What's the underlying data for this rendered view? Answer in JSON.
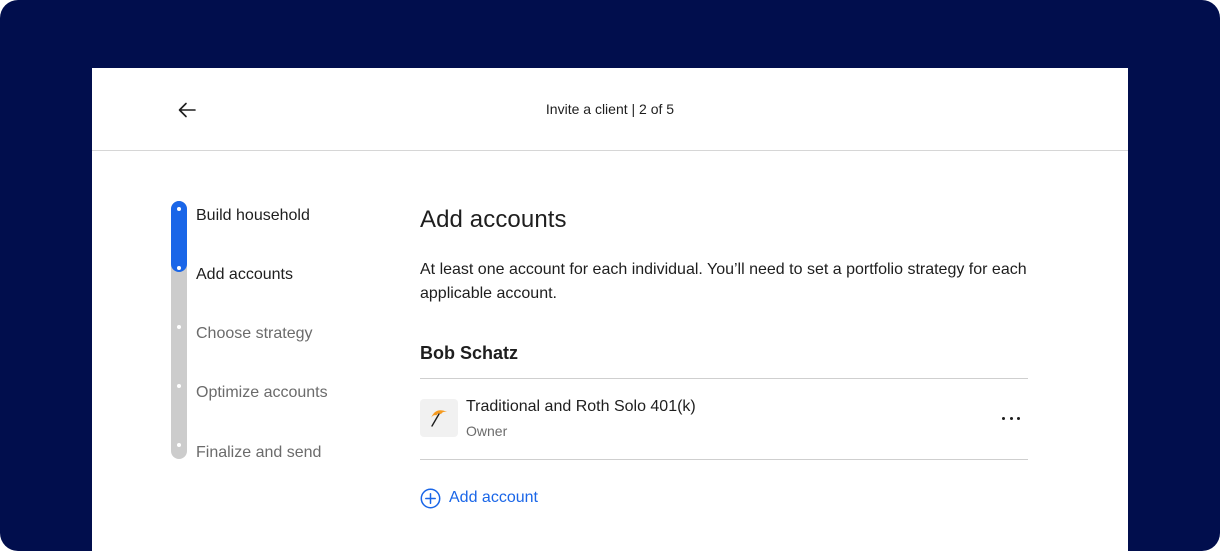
{
  "header": {
    "back_icon": "arrow-left-icon",
    "title": "Invite a client | 2 of 5"
  },
  "stepper": {
    "steps": [
      {
        "label": "Build household",
        "state": "complete"
      },
      {
        "label": "Add accounts",
        "state": "current"
      },
      {
        "label": "Choose strategy",
        "state": "upcoming"
      },
      {
        "label": "Optimize accounts",
        "state": "upcoming"
      },
      {
        "label": "Finalize and send",
        "state": "upcoming"
      }
    ],
    "progress_fraction": 0.25,
    "active_color": "#1a66e8",
    "inactive_color": "#cccccc"
  },
  "main": {
    "title": "Add accounts",
    "description": "At least one account for each individual. You’ll need to set a portfolio strategy for each applicable account.",
    "person": {
      "name": "Bob Schatz",
      "accounts": [
        {
          "name": "Traditional and Roth Solo 401(k)",
          "role": "Owner",
          "icon": "umbrella-icon",
          "menu_icon": "more-horizontal-icon"
        }
      ]
    },
    "add_account": {
      "label": "Add account",
      "icon": "plus-circle-icon"
    }
  },
  "colors": {
    "background": "#010e4d",
    "accent": "#1a66e8",
    "text": "#1e1e1e",
    "muted": "#6b6b6b"
  }
}
